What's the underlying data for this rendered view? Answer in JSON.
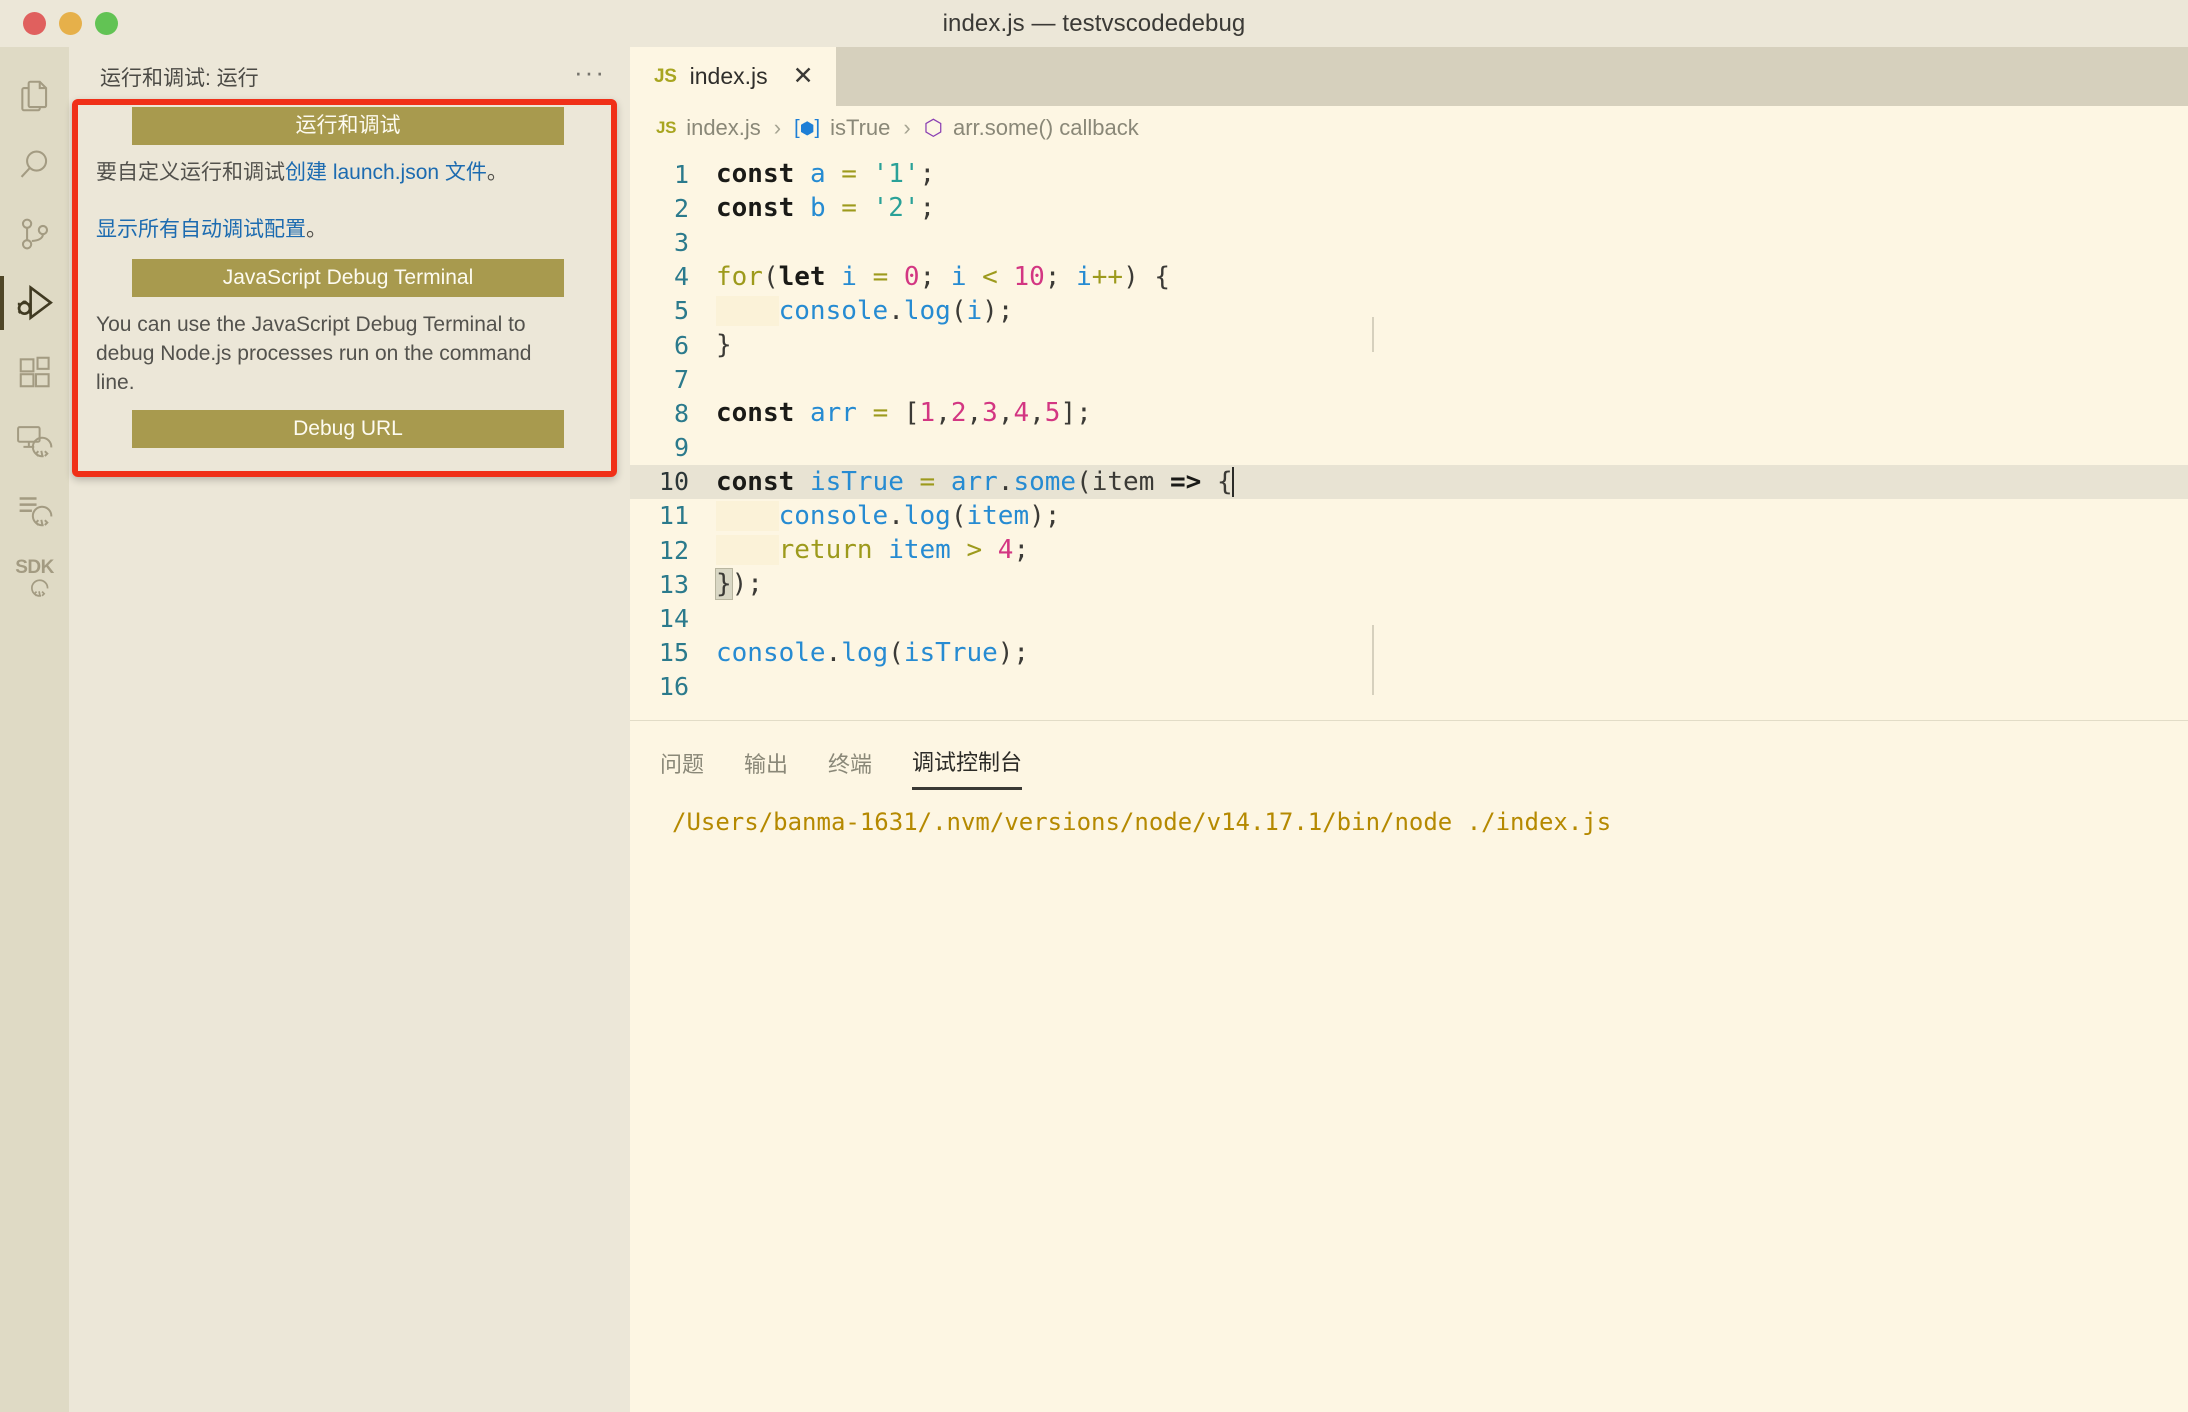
{
  "window": {
    "title": "index.js — testvscodedebug",
    "traffic_lights": [
      "close",
      "minimize",
      "zoom"
    ]
  },
  "activity_bar": {
    "items": [
      {
        "name": "explorer",
        "icon": "files-icon",
        "active": false
      },
      {
        "name": "search",
        "icon": "search-icon",
        "active": false
      },
      {
        "name": "source-control",
        "icon": "source-control-icon",
        "active": false
      },
      {
        "name": "run-and-debug",
        "icon": "run-debug-icon",
        "active": true
      },
      {
        "name": "extensions",
        "icon": "extensions-icon",
        "active": false
      },
      {
        "name": "remote-explorer",
        "icon": "remote-explorer-icon",
        "active": false
      },
      {
        "name": "output-channels",
        "icon": "list-code-icon",
        "active": false
      },
      {
        "name": "sdk",
        "icon": "sdk-icon",
        "label": "SDK",
        "active": false
      }
    ]
  },
  "sidebar": {
    "title": "运行和调试: 运行",
    "more_actions": "···",
    "run_and_debug_button": "运行和调试",
    "customize_text_prefix": "要自定义运行和调试",
    "customize_link": "创建 launch.json 文件",
    "customize_text_suffix": "。",
    "show_all_configs_link": "显示所有自动调试配置",
    "show_all_configs_suffix": "。",
    "js_debug_terminal_button": "JavaScript Debug Terminal",
    "js_debug_terminal_desc": "You can use the JavaScript Debug Terminal to debug Node.js processes run on the command line.",
    "debug_url_button": "Debug URL",
    "highlight_color": "#f03018",
    "button_color": "#a89a4e",
    "link_color": "#1c6bb0"
  },
  "editor": {
    "tab": {
      "file_type": "JS",
      "name": "index.js",
      "close": "✕"
    },
    "breadcrumbs": [
      {
        "icon": "js-icon",
        "label": "index.js"
      },
      {
        "icon": "variable-icon",
        "label": "isTrue"
      },
      {
        "icon": "function-icon",
        "label": "arr.some() callback"
      }
    ],
    "breadcrumb_separator": "›",
    "active_line": 10,
    "lines": [
      {
        "n": 1,
        "text": "const a = '1';"
      },
      {
        "n": 2,
        "text": "const b = '2';"
      },
      {
        "n": 3,
        "text": ""
      },
      {
        "n": 4,
        "text": "for(let i = 0; i < 10; i++) {"
      },
      {
        "n": 5,
        "text": "    console.log(i);"
      },
      {
        "n": 6,
        "text": "}"
      },
      {
        "n": 7,
        "text": ""
      },
      {
        "n": 8,
        "text": "const arr = [1,2,3,4,5];"
      },
      {
        "n": 9,
        "text": ""
      },
      {
        "n": 10,
        "text": "const isTrue = arr.some(item => {"
      },
      {
        "n": 11,
        "text": "    console.log(item);"
      },
      {
        "n": 12,
        "text": "    return item > 4;"
      },
      {
        "n": 13,
        "text": "});"
      },
      {
        "n": 14,
        "text": ""
      },
      {
        "n": 15,
        "text": "console.log(isTrue);"
      },
      {
        "n": 16,
        "text": ""
      }
    ]
  },
  "bottom_panel": {
    "tabs": [
      {
        "label": "问题",
        "active": false
      },
      {
        "label": "输出",
        "active": false
      },
      {
        "label": "终端",
        "active": false
      },
      {
        "label": "调试控制台",
        "active": true
      }
    ],
    "console_output": "/Users/banma-1631/.nvm/versions/node/v14.17.1/bin/node ./index.js",
    "console_color": "#b58900"
  }
}
